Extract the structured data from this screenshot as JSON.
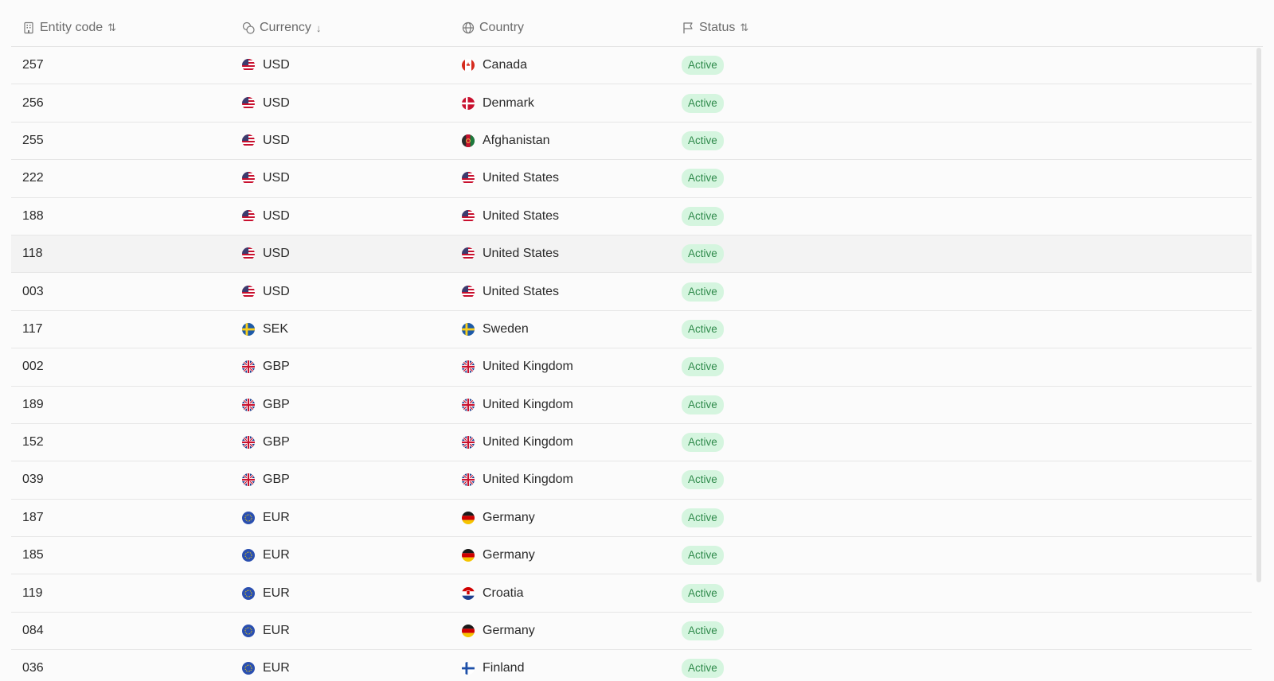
{
  "columns": {
    "entity": {
      "label": "Entity code",
      "sort_glyph": "⇅"
    },
    "currency": {
      "label": "Currency",
      "sort_glyph": "↓"
    },
    "country": {
      "label": "Country"
    },
    "status": {
      "label": "Status",
      "sort_glyph": "⇅"
    }
  },
  "rows": [
    {
      "code": "257",
      "currency": "USD",
      "currency_flag": "us",
      "country": "Canada",
      "country_flag": "ca",
      "status": "Active"
    },
    {
      "code": "256",
      "currency": "USD",
      "currency_flag": "us",
      "country": "Denmark",
      "country_flag": "dk",
      "status": "Active"
    },
    {
      "code": "255",
      "currency": "USD",
      "currency_flag": "us",
      "country": "Afghanistan",
      "country_flag": "af",
      "status": "Active"
    },
    {
      "code": "222",
      "currency": "USD",
      "currency_flag": "us",
      "country": "United States",
      "country_flag": "us",
      "status": "Active"
    },
    {
      "code": "188",
      "currency": "USD",
      "currency_flag": "us",
      "country": "United States",
      "country_flag": "us",
      "status": "Active"
    },
    {
      "code": "118",
      "currency": "USD",
      "currency_flag": "us",
      "country": "United States",
      "country_flag": "us",
      "status": "Active",
      "hover": true
    },
    {
      "code": "003",
      "currency": "USD",
      "currency_flag": "us",
      "country": "United States",
      "country_flag": "us",
      "status": "Active"
    },
    {
      "code": "117",
      "currency": "SEK",
      "currency_flag": "se",
      "country": "Sweden",
      "country_flag": "se",
      "status": "Active"
    },
    {
      "code": "002",
      "currency": "GBP",
      "currency_flag": "gb",
      "country": "United Kingdom",
      "country_flag": "gb",
      "status": "Active"
    },
    {
      "code": "189",
      "currency": "GBP",
      "currency_flag": "gb",
      "country": "United Kingdom",
      "country_flag": "gb",
      "status": "Active"
    },
    {
      "code": "152",
      "currency": "GBP",
      "currency_flag": "gb",
      "country": "United Kingdom",
      "country_flag": "gb",
      "status": "Active"
    },
    {
      "code": "039",
      "currency": "GBP",
      "currency_flag": "gb",
      "country": "United Kingdom",
      "country_flag": "gb",
      "status": "Active"
    },
    {
      "code": "187",
      "currency": "EUR",
      "currency_flag": "eu",
      "country": "Germany",
      "country_flag": "de",
      "status": "Active"
    },
    {
      "code": "185",
      "currency": "EUR",
      "currency_flag": "eu",
      "country": "Germany",
      "country_flag": "de",
      "status": "Active"
    },
    {
      "code": "119",
      "currency": "EUR",
      "currency_flag": "eu",
      "country": "Croatia",
      "country_flag": "hr",
      "status": "Active"
    },
    {
      "code": "084",
      "currency": "EUR",
      "currency_flag": "eu",
      "country": "Germany",
      "country_flag": "de",
      "status": "Active"
    },
    {
      "code": "036",
      "currency": "EUR",
      "currency_flag": "eu",
      "country": "Finland",
      "country_flag": "fi",
      "status": "Active"
    }
  ],
  "colors": {
    "badge_bg": "#d5f5df",
    "badge_text": "#2f8a4b",
    "row_hover": "#f3f3f3"
  }
}
